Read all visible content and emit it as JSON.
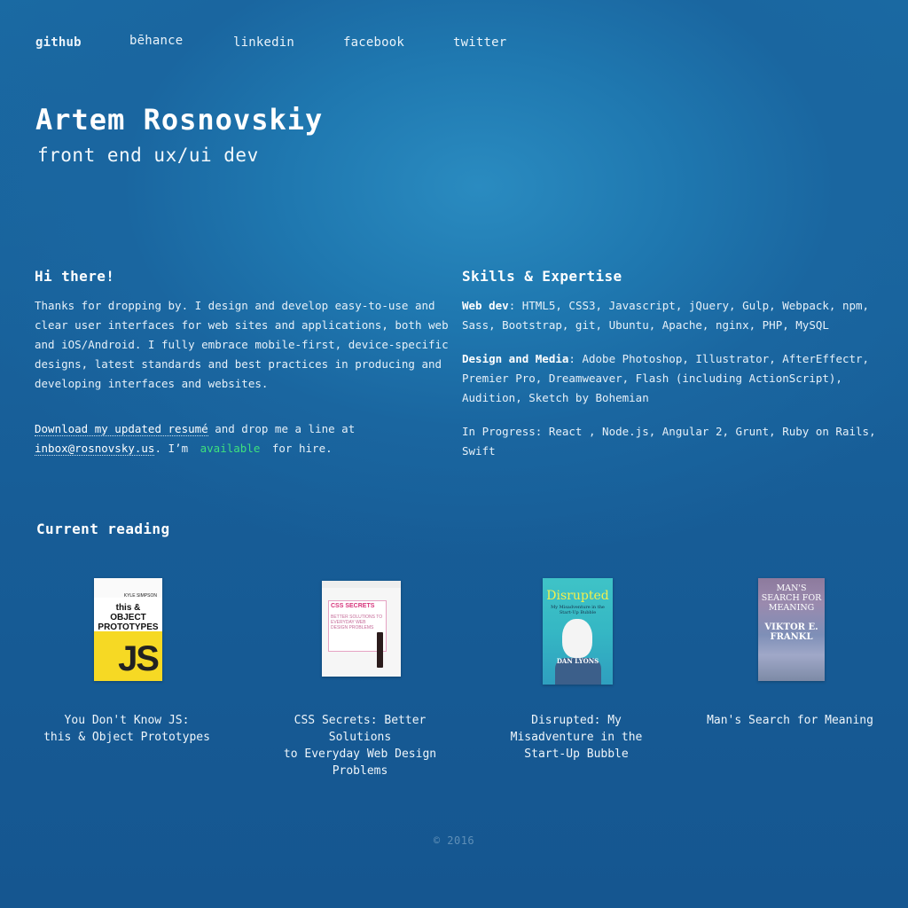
{
  "nav": {
    "github": "github",
    "behance": "bēhance",
    "linkedin": "linkedin",
    "facebook": "facebook",
    "twitter": "twitter"
  },
  "hero": {
    "name": "Artem Rosnovskiy",
    "role": "front end ux/ui dev"
  },
  "about": {
    "heading": "Hi there!",
    "intro": "Thanks for dropping by. I design and develop easy-to-use and clear user interfaces for web sites and applications, both web and iOS/Android. I fully embrace mobile-first, device-specific designs, latest standards and best practices in producing and developing interfaces and websites.",
    "resume_link": "Download my updated resumé",
    "drop_line": " and drop me a line at ",
    "email": "inbox@rosnovsky.us",
    "im": ". I’m ",
    "available": "available",
    "for_hire": " for hire."
  },
  "skills": {
    "heading": "Skills & Expertise",
    "webdev_label": "Web dev",
    "webdev": ": HTML5, CSS3, Javascript, jQuery, Gulp, Webpack, npm, Sass, Bootstrap, git, Ubuntu, Apache, nginx, PHP, MySQL",
    "design_label": "Design and Media",
    "design": ": Adobe Photoshop, Illustrator, AfterEffectr, Premier Pro, Dreamweaver, Flash (including ActionScript), Audition, Sketch by Bohemian",
    "progress": "In Progress: React , Node.js, Angular 2, Grunt, Ruby on Rails, Swift"
  },
  "reading": {
    "heading": "Current reading",
    "books": [
      {
        "caption": "You Don't Know JS:\nthis & Object Prototypes",
        "cover_author": "KYLE SIMPSON",
        "cover_title": "this & OBJECT PROTOTYPES",
        "cover_mark": "JS",
        "color": "#f6d924"
      },
      {
        "caption": "CSS Secrets: Better\nSolutions\nto Everyday Web Design\nProblems",
        "cover_title": "CSS SECRETS",
        "cover_subtitle": "BETTER SOLUTIONS TO EVERYDAY WEB DESIGN PROBLEMS",
        "color": "#d6337a"
      },
      {
        "caption": "Disrupted: My\nMisadventure in the\nStart-Up Bubble",
        "cover_title": "Disrupted",
        "cover_subtitle": "My Misadventure in the Start-Up Bubble",
        "cover_author": "DAN LYONS",
        "color": "#3fc3c7"
      },
      {
        "caption": "Man's Search for Meaning",
        "cover_title": "MAN'S SEARCH FOR MEANING",
        "cover_author": "VIKTOR E. FRANKL",
        "color": "#8d7a9d"
      }
    ]
  },
  "footer": {
    "copyright": "© 2016"
  },
  "colors": {
    "background": "#155a92",
    "available": "#3ee07e"
  }
}
